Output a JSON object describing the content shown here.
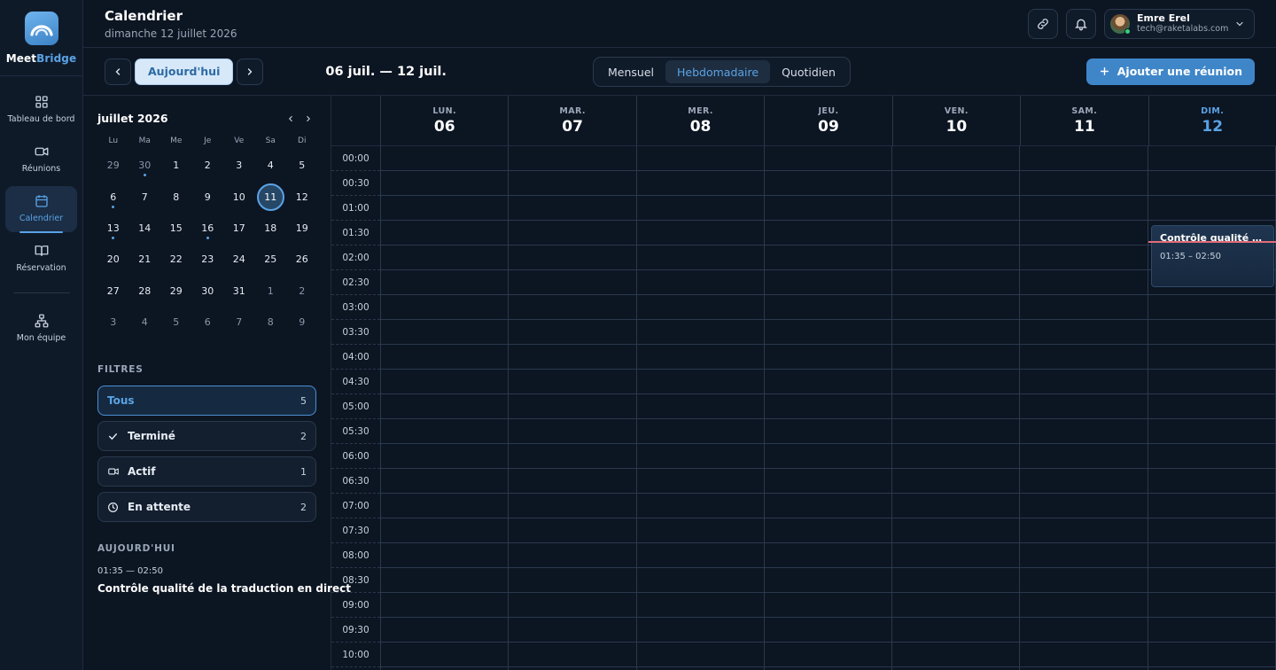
{
  "brand": {
    "part1": "Meet",
    "part2": "Bridge"
  },
  "rail": [
    {
      "label": "Tableau de bord",
      "icon": "grid-icon",
      "active": false
    },
    {
      "label": "Réunions",
      "icon": "video-icon",
      "active": false
    },
    {
      "label": "Calendrier",
      "icon": "calendar-icon",
      "active": true
    },
    {
      "label": "Réservation",
      "icon": "book-icon",
      "active": false
    },
    {
      "label": "Mon équipe",
      "icon": "team-icon",
      "active": false
    }
  ],
  "header": {
    "title": "Calendrier",
    "subtitle": "dimanche 12 juillet 2026"
  },
  "user": {
    "name": "Emre Erel",
    "email": "tech@raketalabs.com"
  },
  "toolbar": {
    "today_label": "Aujourd'hui",
    "range": "06 juil. — 12 juil.",
    "views": [
      "Mensuel",
      "Hebdomadaire",
      "Quotidien"
    ],
    "active_view": "Hebdomadaire",
    "add_label": "Ajouter une réunion"
  },
  "mini_calendar": {
    "title": "juillet 2026",
    "weekdays": [
      "Lu",
      "Ma",
      "Me",
      "Je",
      "Ve",
      "Sa",
      "Di"
    ],
    "weeks": [
      [
        "29",
        "30",
        "1",
        "2",
        "3",
        "4",
        "5"
      ],
      [
        "6",
        "7",
        "8",
        "9",
        "10",
        "11",
        "12"
      ],
      [
        "13",
        "14",
        "15",
        "16",
        "17",
        "18",
        "19"
      ],
      [
        "20",
        "21",
        "22",
        "23",
        "24",
        "25",
        "26"
      ],
      [
        "27",
        "28",
        "29",
        "30",
        "31",
        "1",
        "2"
      ],
      [
        "3",
        "4",
        "5",
        "6",
        "7",
        "8",
        "9"
      ]
    ],
    "selected": "11",
    "event_days": [
      "30",
      "6",
      "13",
      "16"
    ]
  },
  "filters": {
    "title": "FILTRES",
    "items": [
      {
        "label": "Tous",
        "count": "5",
        "icon": "",
        "active": true
      },
      {
        "label": "Terminé",
        "count": "2",
        "icon": "check-icon",
        "active": false
      },
      {
        "label": "Actif",
        "count": "1",
        "icon": "video-icon",
        "active": false
      },
      {
        "label": "En attente",
        "count": "2",
        "icon": "clock-icon",
        "active": false
      }
    ]
  },
  "today": {
    "title": "AUJOURD'HUI",
    "items": [
      {
        "time": "01:35 — 02:50",
        "title": "Contrôle qualité de la traduction en direct"
      }
    ]
  },
  "week": {
    "days": [
      {
        "name": "LUN.",
        "num": "06",
        "today": false
      },
      {
        "name": "MAR.",
        "num": "07",
        "today": false
      },
      {
        "name": "MER.",
        "num": "08",
        "today": false
      },
      {
        "name": "JEU.",
        "num": "09",
        "today": false
      },
      {
        "name": "VEN.",
        "num": "10",
        "today": false
      },
      {
        "name": "SAM.",
        "num": "11",
        "today": false
      },
      {
        "name": "DIM.",
        "num": "12",
        "today": true
      }
    ],
    "times": [
      "00:00",
      "00:30",
      "01:00",
      "01:30",
      "02:00",
      "02:30",
      "03:00",
      "03:30",
      "04:00",
      "04:30",
      "05:00",
      "05:30",
      "06:00",
      "06:30",
      "07:00",
      "07:30",
      "08:00",
      "08:30",
      "09:00",
      "09:30",
      "10:00"
    ],
    "event": {
      "title": "Contrôle qualité de la traduction en direct",
      "time": "01:35 – 02:50"
    }
  },
  "colors": {
    "accent": "#5aa3e6",
    "now_line": "#e36b78",
    "background": "#0c1522"
  }
}
